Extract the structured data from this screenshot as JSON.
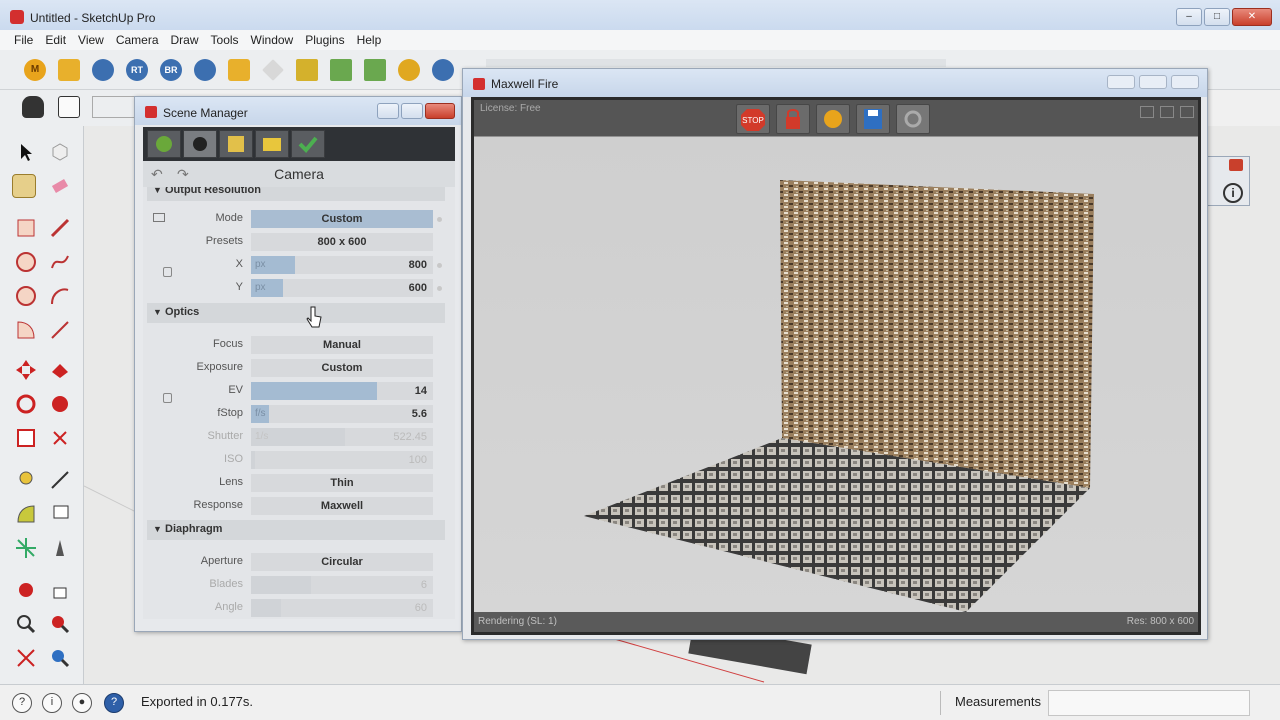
{
  "window": {
    "title": "Untitled - SketchUp Pro",
    "controls": [
      "–",
      "□",
      "✕"
    ]
  },
  "menu": [
    "File",
    "Edit",
    "View",
    "Camera",
    "Draw",
    "Tools",
    "Window",
    "Plugins",
    "Help"
  ],
  "toolbar": {
    "labels": [
      "M",
      "RT",
      "BR"
    ]
  },
  "scene_manager": {
    "title": "Scene Manager",
    "section_header": "Camera",
    "sections": {
      "output": "Output Resolution",
      "optics": "Optics",
      "diaphragm": "Diaphragm"
    },
    "output_resolution": {
      "mode_label": "Mode",
      "mode_value": "Custom",
      "presets_label": "Presets",
      "presets_value": "800 x 600",
      "x_label": "X",
      "x_unit": "px",
      "x_value": "800",
      "y_label": "Y",
      "y_unit": "px",
      "y_value": "600"
    },
    "optics": {
      "focus_label": "Focus",
      "focus_value": "Manual",
      "exposure_label": "Exposure",
      "exposure_value": "Custom",
      "ev_label": "EV",
      "ev_value": "14",
      "fstop_label": "fStop",
      "fstop_unit": "f/s",
      "fstop_value": "5.6",
      "shutter_label": "Shutter",
      "shutter_unit": "1/s",
      "shutter_value": "522.45",
      "iso_label": "ISO",
      "iso_value": "100",
      "lens_label": "Lens",
      "lens_value": "Thin",
      "response_label": "Response",
      "response_value": "Maxwell"
    },
    "diaphragm": {
      "aperture_label": "Aperture",
      "aperture_value": "Circular",
      "blades_label": "Blades",
      "blades_value": "6",
      "angle_label": "Angle",
      "angle_value": "60"
    }
  },
  "maxwell": {
    "title": "Maxwell Fire",
    "license": "License: Free",
    "buttons": [
      "STOP"
    ],
    "status_left": "Rendering (SL: 1)",
    "status_right": "Res: 800 x 600"
  },
  "statusbar": {
    "message": "Exported in 0.177s.",
    "measurements_label": "Measurements",
    "measurements_value": ""
  },
  "colors": {
    "accent": "#a4bbd2",
    "title_gradient": "#c9d9ee",
    "close_red": "#c9402c"
  }
}
